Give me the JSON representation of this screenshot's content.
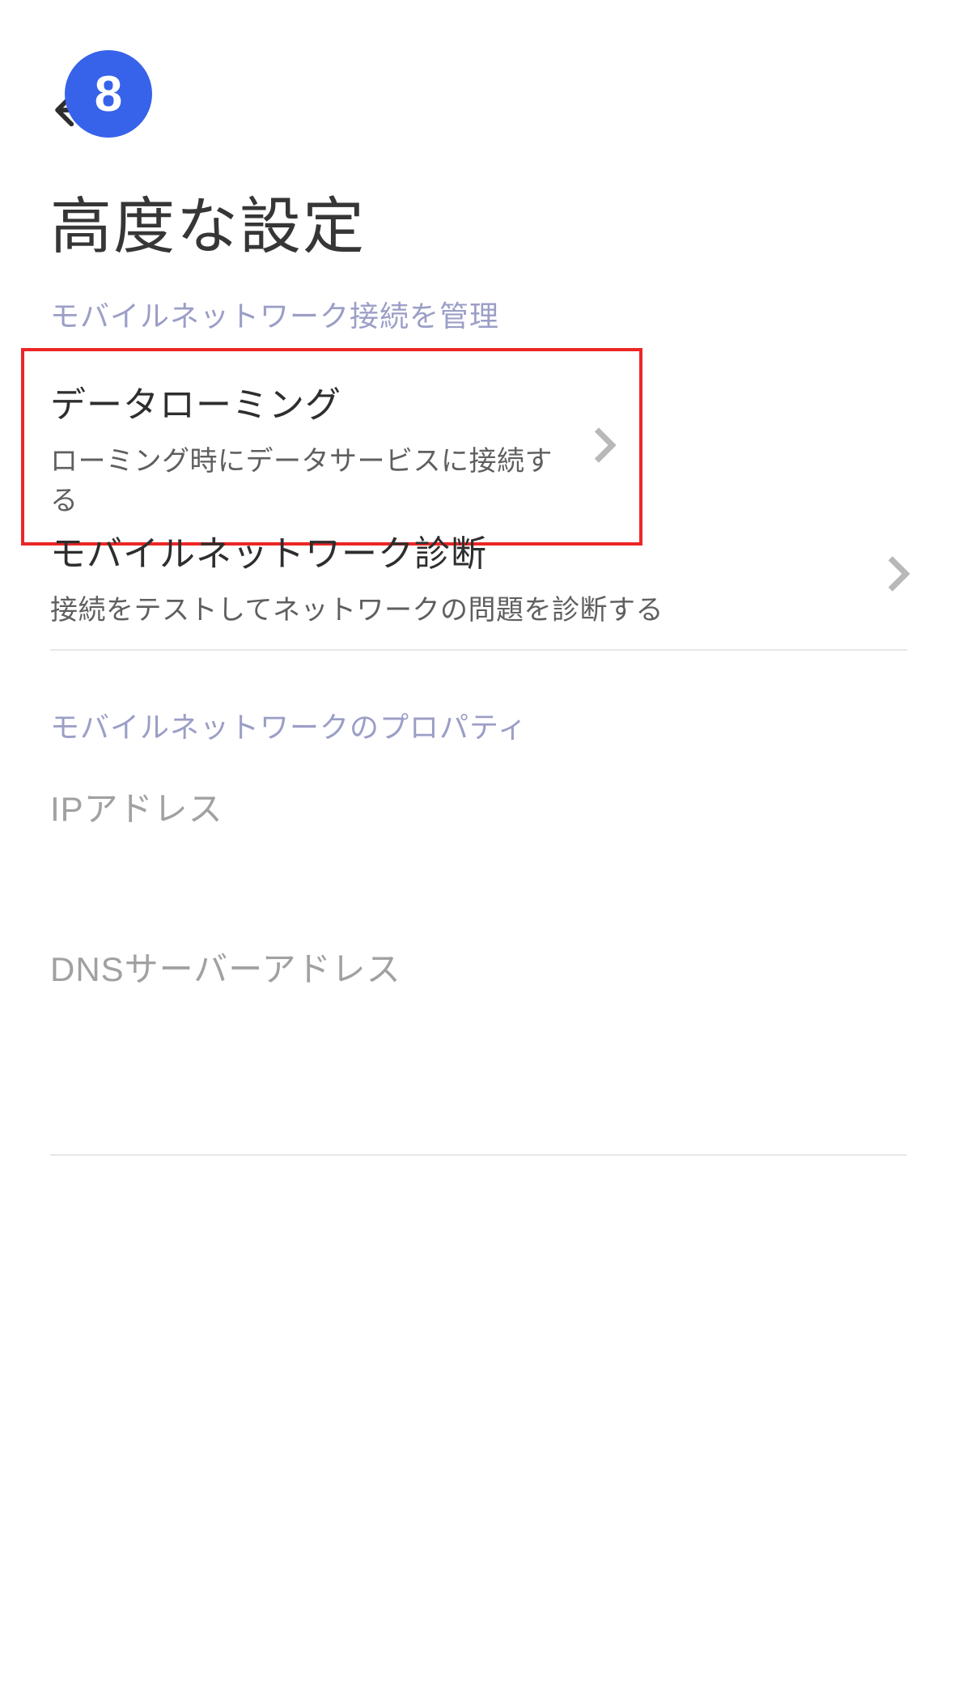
{
  "step_badge": "8",
  "page_title": "高度な設定",
  "section1_header": "モバイルネットワーク接続を管理",
  "items": [
    {
      "title": "データローミング",
      "sub": "ローミング時にデータサービスに接続する"
    },
    {
      "title": "モバイルネットワーク診断",
      "sub": "接続をテストしてネットワークの問題を診断する"
    }
  ],
  "section2_header": "モバイルネットワークのプロパティ",
  "props": {
    "ip_label": "IPアドレス",
    "dns_label": "DNSサーバーアドレス"
  },
  "highlight_index": 0,
  "colors": {
    "accent": "#3762ea",
    "highlight_border": "#ec2626"
  }
}
